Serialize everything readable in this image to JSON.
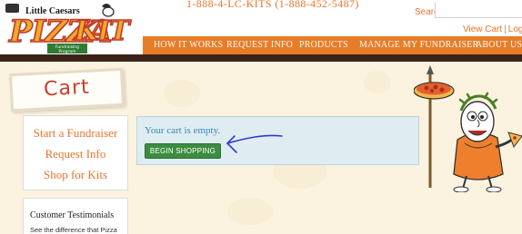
{
  "brand": {
    "company": "Little Caesars",
    "logo_text": "PIZZA KIT",
    "logo_subtext": "Fundraising Program"
  },
  "header": {
    "phone": "1-888-4-LC-KITS (1-888-452-5487)",
    "search_label": "Search",
    "search_value": "",
    "view_cart": "View Cart",
    "separator": "|",
    "login": "Login"
  },
  "nav": {
    "items": [
      {
        "label": "HOW IT WORKS"
      },
      {
        "label": "REQUEST INFO"
      },
      {
        "label": "PRODUCTS"
      },
      {
        "label": "MANAGE MY FUNDRAISER"
      },
      {
        "label": "ABOUT US"
      }
    ]
  },
  "page": {
    "title": "Cart"
  },
  "sidebar": {
    "links": [
      {
        "label": "Start a Fundraiser"
      },
      {
        "label": "Request Info"
      },
      {
        "label": "Shop for Kits"
      }
    ],
    "testimonials": {
      "title": "Customer Testimonials",
      "text": "See the difference that Pizza"
    }
  },
  "cart": {
    "empty_message": "Your cart is empty.",
    "begin_button": "BEGIN SHOPPING"
  },
  "colors": {
    "accent_orange": "#e87c27",
    "button_green": "#3c8d3f",
    "panel_blue": "#dfedf3",
    "title_red": "#c93b2b"
  }
}
